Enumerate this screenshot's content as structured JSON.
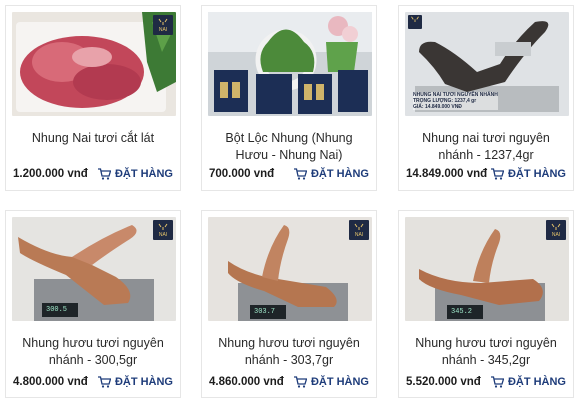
{
  "products": [
    {
      "title": "Nhung Nai tươi cắt lát",
      "price": "1.200.000 vnđ",
      "order_label": "ĐẶT HÀNG"
    },
    {
      "title": "Bột Lộc Nhung (Nhung Hươu - Nhung Nai)",
      "price": "700.000 vnđ",
      "order_label": "ĐẶT HÀNG"
    },
    {
      "title": "Nhung nai tươi nguyên nhánh - 1237,4gr",
      "price": "14.849.000 vnđ",
      "order_label": "ĐẶT HÀNG"
    },
    {
      "title": "Nhung hươu tươi nguyên nhánh - 300,5gr",
      "price": "4.800.000 vnđ",
      "order_label": "ĐẶT HÀNG",
      "scale_reading": "300.5"
    },
    {
      "title": "Nhung hươu tươi nguyên nhánh - 303,7gr",
      "price": "4.860.000 vnđ",
      "order_label": "ĐẶT HÀNG",
      "scale_reading": "303.7"
    },
    {
      "title": "Nhung hươu tươi nguyên nhánh - 345,2gr",
      "price": "5.520.000 vnđ",
      "order_label": "ĐẶT HÀNG",
      "scale_reading": "345.2"
    }
  ],
  "overlay": {
    "line1": "NHUNG NAI TƯƠI NGUYÊN NHÁNH",
    "line2": "TRỌNG LƯỢNG: 1237,4 gr",
    "line3": "GIÁ: 14.849.000 VNĐ"
  },
  "logo_text": "NAI",
  "colors": {
    "accent": "#1e3c7a",
    "logo_bg": "#1f2a44"
  }
}
